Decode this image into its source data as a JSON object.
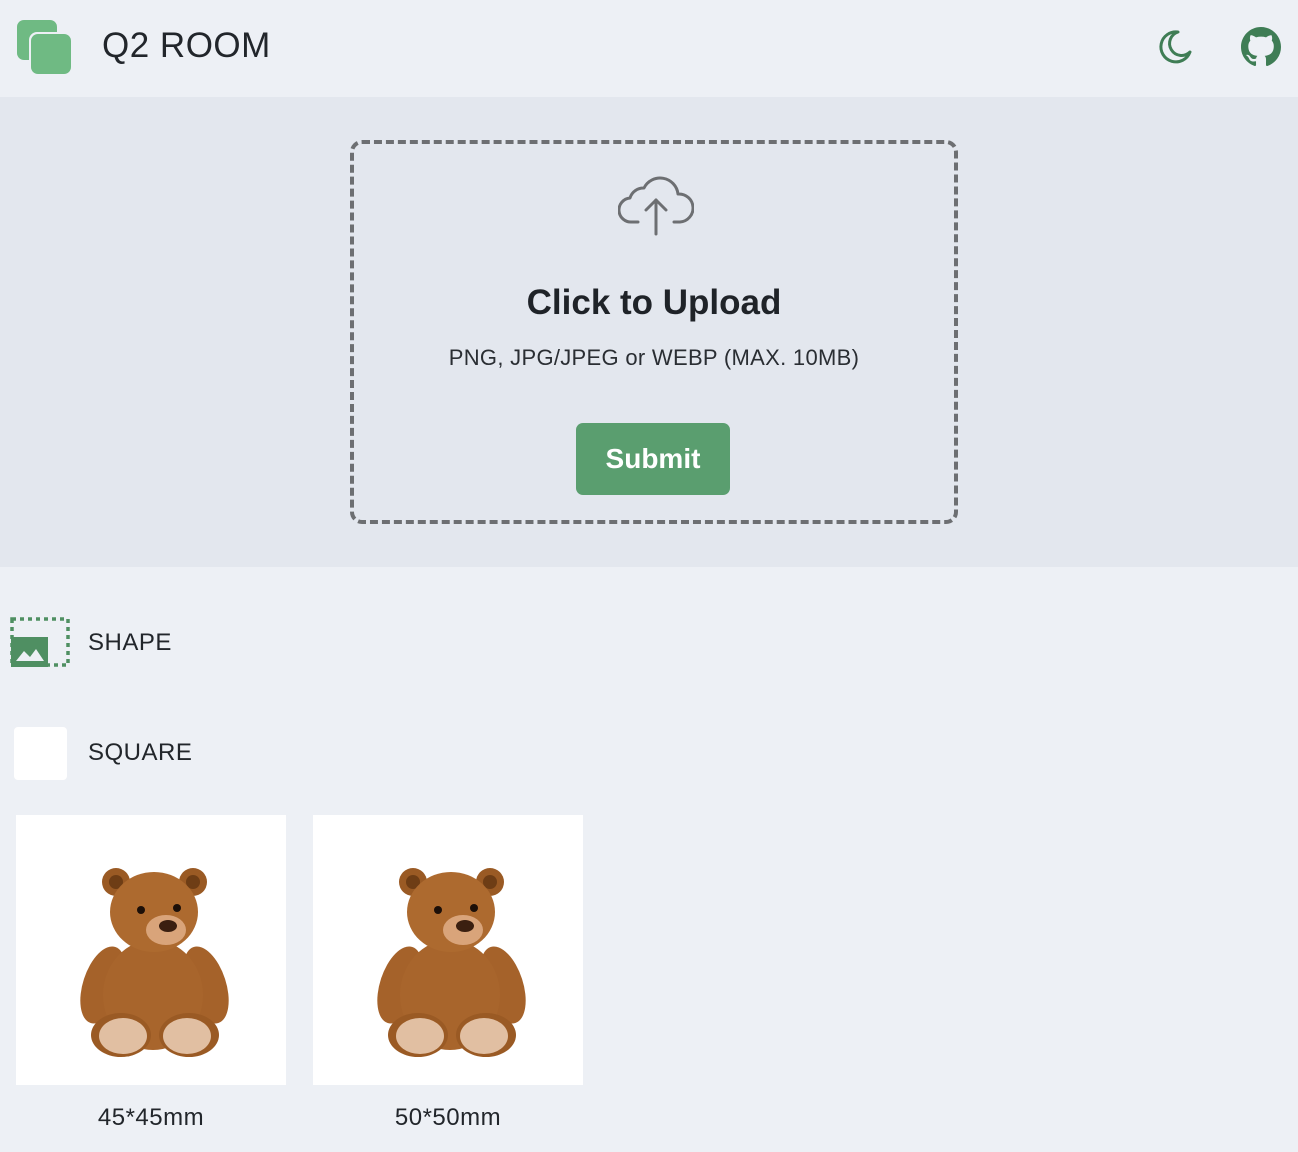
{
  "header": {
    "title": "Q2 ROOM",
    "logo_icon": "stacked-squares-logo",
    "theme_icon": "moon-icon",
    "github_icon": "github-icon",
    "accent_color": "#5a9e6f"
  },
  "upload": {
    "icon": "cloud-upload-icon",
    "title": "Click to Upload",
    "hint": "PNG, JPG/JPEG or WEBP (MAX. 10MB)",
    "submit_label": "Submit",
    "submit_color": "#5a9e6f"
  },
  "options": {
    "shape_label": "SHAPE",
    "shape_icon": "shape-image-icon",
    "square_label": "SQUARE"
  },
  "products": [
    {
      "size": "45*45mm",
      "image": "teddy-bear"
    },
    {
      "size": "50*50mm",
      "image": "teddy-bear"
    }
  ]
}
